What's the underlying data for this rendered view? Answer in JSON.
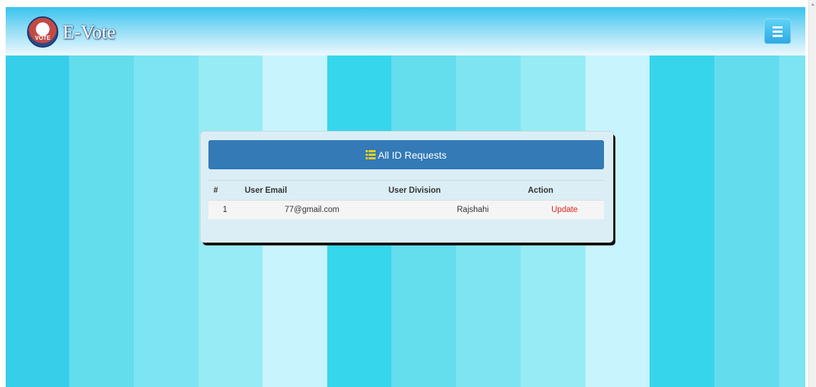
{
  "brand": {
    "logo_text": "VOTE",
    "title": "E-Vote"
  },
  "navbar": {
    "menu_icon": "hamburger-icon"
  },
  "background": {
    "stripe_colors": [
      "#36cee9",
      "#63dcec",
      "#7ce4f2",
      "#97ebf4",
      "#c8f4fd",
      "#36d6ec",
      "#64dded",
      "#7ee4f2",
      "#97ebf4",
      "#c8f4fd",
      "#36d5ec",
      "#63dcee",
      "#7ce4f2"
    ]
  },
  "panel": {
    "title": "All ID Requests",
    "title_icon": "list-icon",
    "columns": [
      "#",
      "User Email",
      "User Division",
      "Action"
    ],
    "rows": [
      {
        "index": "1",
        "email": "77@gmail.com",
        "division": "Rajshahi",
        "action": "Update"
      }
    ]
  },
  "colors": {
    "header_blue": "#337ab7",
    "action_red": "#e0241f"
  }
}
